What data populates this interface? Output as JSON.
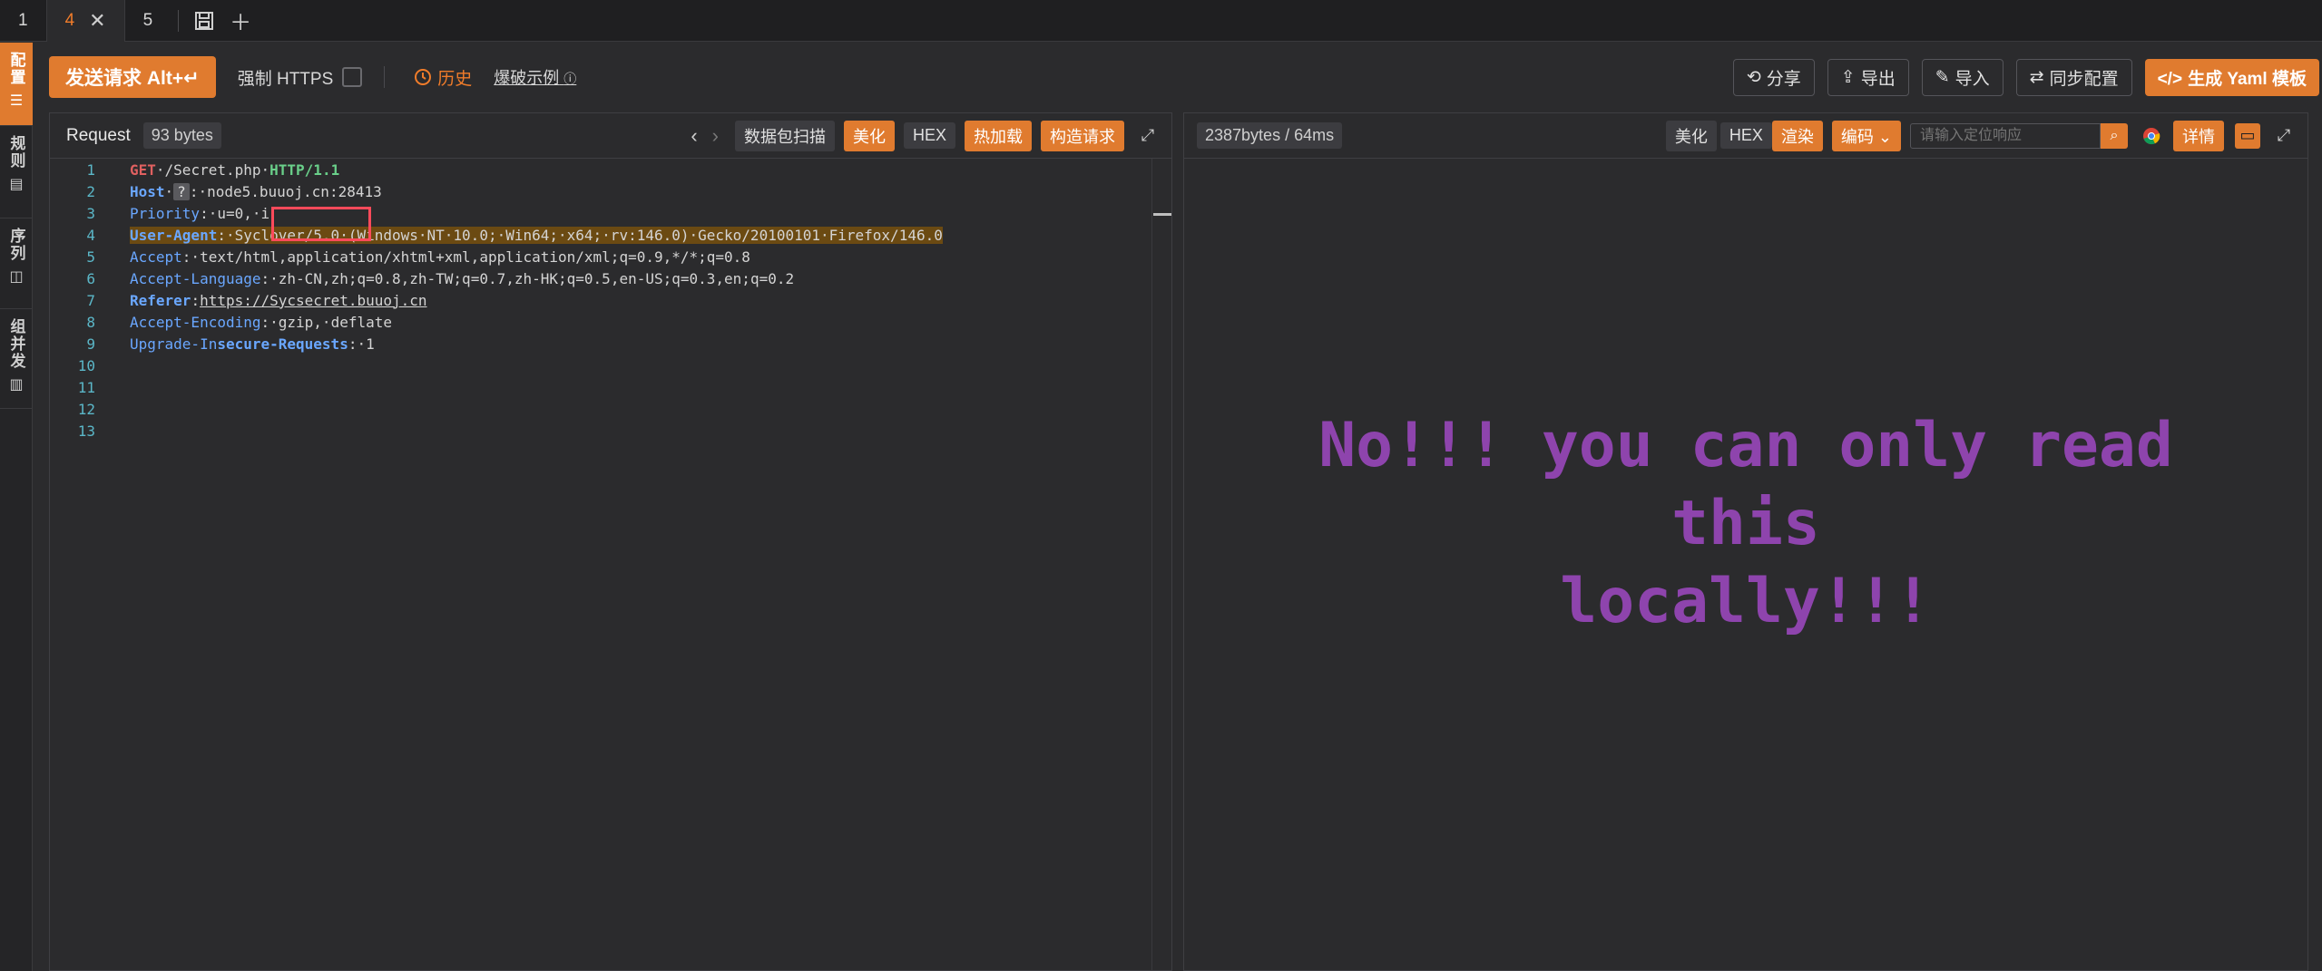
{
  "tabs": [
    {
      "label": "1"
    },
    {
      "label": "4",
      "active": true
    },
    {
      "label": "5"
    }
  ],
  "rail": [
    {
      "label": "配置",
      "icon": "sliders-icon"
    },
    {
      "label": "规则",
      "icon": "clipboard-icon"
    },
    {
      "label": "序列",
      "icon": "layers-icon"
    },
    {
      "label": "组并发",
      "icon": "columns-icon"
    }
  ],
  "toolbar": {
    "send_label": "发送请求 Alt+↵",
    "force_https": "强制 HTTPS",
    "history": "历史",
    "fuzz_example": "爆破示例",
    "share": "分享",
    "export": "导出",
    "import": "导入",
    "sync": "同步配置",
    "gen_yaml": "生成 Yaml 模板"
  },
  "request": {
    "title": "Request",
    "bytes": "93 bytes",
    "scan": "数据包扫描",
    "beautify": "美化",
    "hex": "HEX",
    "hotload": "热加载",
    "build": "构造请求",
    "lines": [
      {
        "n": "1"
      },
      {
        "n": "2"
      },
      {
        "n": "3"
      },
      {
        "n": "4"
      },
      {
        "n": "5"
      },
      {
        "n": "6"
      },
      {
        "n": "7"
      },
      {
        "n": "8"
      },
      {
        "n": "9"
      },
      {
        "n": "10"
      },
      {
        "n": "11"
      },
      {
        "n": "12"
      },
      {
        "n": "13"
      }
    ],
    "code": {
      "l1_method": "GET",
      "l1_path": "·/Secret.php·",
      "l1_proto": "HTTP/1.1",
      "l2_key": "Host",
      "l2_q": "?",
      "l2_val": ":·node5.buuoj.cn:28413",
      "l3_key": "Priority",
      "l3_val": ":·u=0,·i",
      "l4_key": "User-Agent",
      "l4_val": ":·Syclover/5.0·(Windows·NT·10.0;·Win64;·x64;·rv:146.0)·Gecko/20100101·Firefox/146.0",
      "l5_key": "Accept",
      "l5_val": ":·text/html,application/xhtml+xml,application/xml;q=0.9,*/*;q=0.8",
      "l6_key": "Accept-Language",
      "l6_val": ":·zh-CN,zh;q=0.8,zh-TW;q=0.7,zh-HK;q=0.5,en-US;q=0.3,en;q=0.2",
      "l7_key": "Referer",
      "l7_val": "https://Sycsecret.buuoj.cn",
      "l8_key": "Accept-Encoding",
      "l8_val": ":·gzip,·deflate",
      "l9_key1": "Upgrade-In",
      "l9_key2": "secure-Requests",
      "l9_val": ":·1"
    }
  },
  "response": {
    "stats": "2387bytes / 64ms",
    "beautify": "美化",
    "hex": "HEX",
    "render": "渲染",
    "encoding": "编码",
    "search_placeholder": "请输入定位响应",
    "details": "详情",
    "rendered_line1": "No!!! you can only read this",
    "rendered_line2": "locally!!!"
  }
}
